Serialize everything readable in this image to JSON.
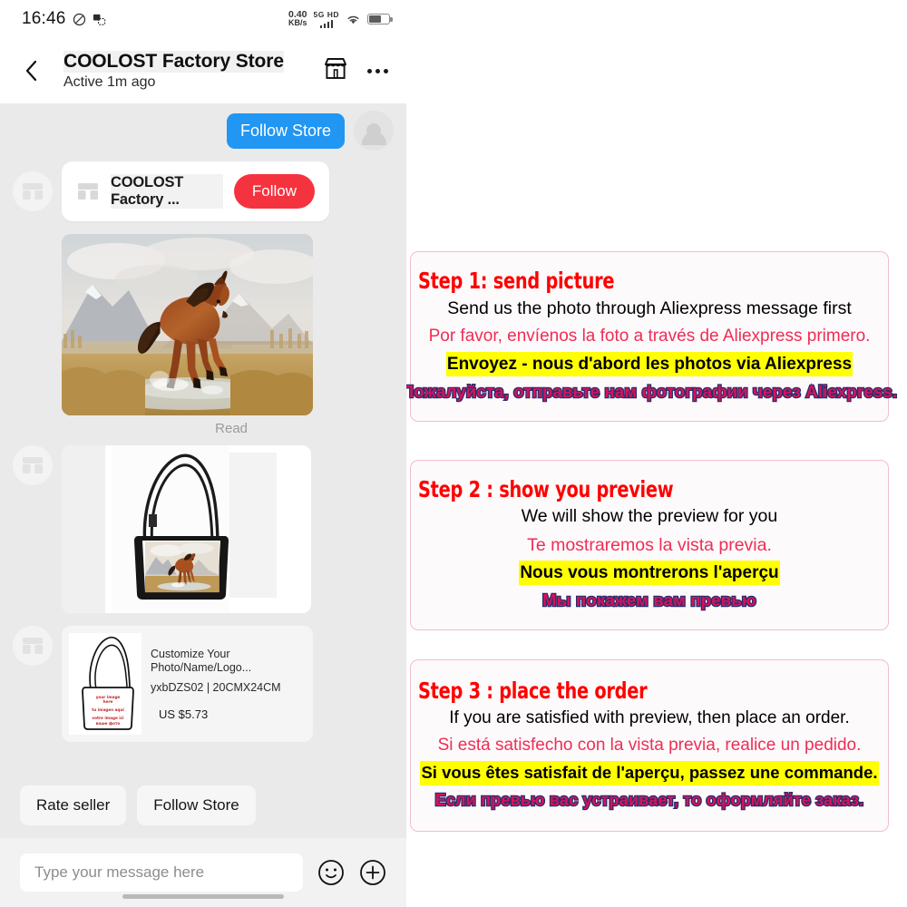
{
  "statusbar": {
    "time": "16:46",
    "data_rate_value": "0.40",
    "data_rate_unit": "KB/s",
    "network": "5G",
    "hd": "HD",
    "icons": [
      "do-not-disturb-icon",
      "screenshot-icon",
      "wifi-icon",
      "battery-icon"
    ]
  },
  "header": {
    "store_name": "COOLOST Factory Store",
    "status": "Active 1m ago",
    "back_icon": "back-chevron-icon",
    "store_icon": "storefront-icon",
    "more_icon": "more-options-icon"
  },
  "chat": {
    "outgoing_bubble": "Follow Store",
    "follow_card": {
      "store_name": "COOLOST Factory ...",
      "follow_label": "Follow"
    },
    "photo_message": {
      "alt": "horse-photo",
      "read_status": "Read"
    },
    "preview_message": {
      "alt": "handbag-preview-with-horse-print"
    },
    "product_card": {
      "title": "Customize Your Photo/Name/Logo...",
      "sku": "yxbDZS02 | 20CMX24CM",
      "price": "US $5.73",
      "alt": "blank-handbag-thumbnail",
      "thumb_text_lines": [
        "your image",
        "here",
        "tu imagen aqui",
        "votre image ici",
        "ваше фото"
      ]
    }
  },
  "quick_actions": [
    {
      "label": "Rate seller",
      "name": "rate-seller-button"
    },
    {
      "label": "Follow Store",
      "name": "follow-store-button"
    }
  ],
  "composer": {
    "placeholder": "Type your message here",
    "value": "",
    "emoji_icon": "emoji-smiley-icon",
    "plus_icon": "add-attachment-icon"
  },
  "colors": {
    "accent_blue": "#2196f3",
    "follow_red": "#f5333f",
    "step_red": "#ff0000",
    "spanish_pink": "#ef2d56",
    "french_highlight": "#ffff00",
    "russian_fill": "#d4145a",
    "russian_stroke": "#2b2d6e",
    "panel_bg": "#eaeaea",
    "box_border": "#f0bfc8"
  },
  "guide": {
    "steps": [
      {
        "title": "Step 1: send picture",
        "en": "Send us the photo through Aliexpress message first",
        "es": "Por favor, envíenos la foto a través de Aliexpress primero.",
        "fr": "Envoyez - nous d'abord les photos via Aliexpress",
        "ru": "Пожалуйста, отправьте нам фотографии через Aliexpress."
      },
      {
        "title": "Step 2 : show you preview",
        "en": "We will show the preview for you",
        "es": "Te mostraremos la vista previa.",
        "fr": "Nous vous montrerons l'aperçu",
        "ru": "Мы покажем вам превью"
      },
      {
        "title": "Step 3 : place the order",
        "en": "If you are satisfied with preview, then place an order.",
        "es": "Si está satisfecho con la vista previa, realice un pedido.",
        "fr": "Si vous êtes satisfait de l'aperçu, passez une commande.",
        "ru": "Если превью вас устраивает, то оформляйте заказ."
      }
    ]
  }
}
